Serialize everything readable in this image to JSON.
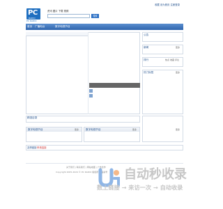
{
  "header": {
    "logo_letters": "PC",
    "logo_sub": "RADIO",
    "logo_caption": "PC RADIO",
    "top_links": [
      "收藏",
      "设为首页",
      "注册登录"
    ],
    "tabs": [
      "资讯",
      "图片",
      "下载",
      "视频"
    ],
    "search_button": "搜索"
  },
  "nav": {
    "items": [
      "首页",
      "广播电台",
      "数字电视节目"
    ]
  },
  "sidebar": {
    "notice_title": "公告",
    "news_title": "新闻",
    "rank_title": "排行",
    "rank_tabs": [
      "热点",
      "收藏",
      "评论"
    ],
    "hot_title": "热门标签",
    "more": "更多"
  },
  "main": {
    "small_section_title": "精选目录",
    "bottom_left_title": "数字电视节目",
    "bottom_right_title": "数字电视节目",
    "more": "更多",
    "friend_links_label": "友情链接",
    "friend_links_value": "申请连接"
  },
  "footer": {
    "line1": "关于我们 | 联系我们 | 网站地图 | 广告合作",
    "line2": "Copyright 2005-2024 © PC RADIO 版权所有 备案号"
  },
  "watermark": {
    "title": "自动秒收录",
    "subtitle": "数上链接 → 来访一次 → 自动收录",
    "logo_color": "#8fb6e6"
  },
  "colors": {
    "accent": "#2f65ad",
    "link": "#1f4f8c",
    "watermark_orange": "#f5b98a"
  }
}
